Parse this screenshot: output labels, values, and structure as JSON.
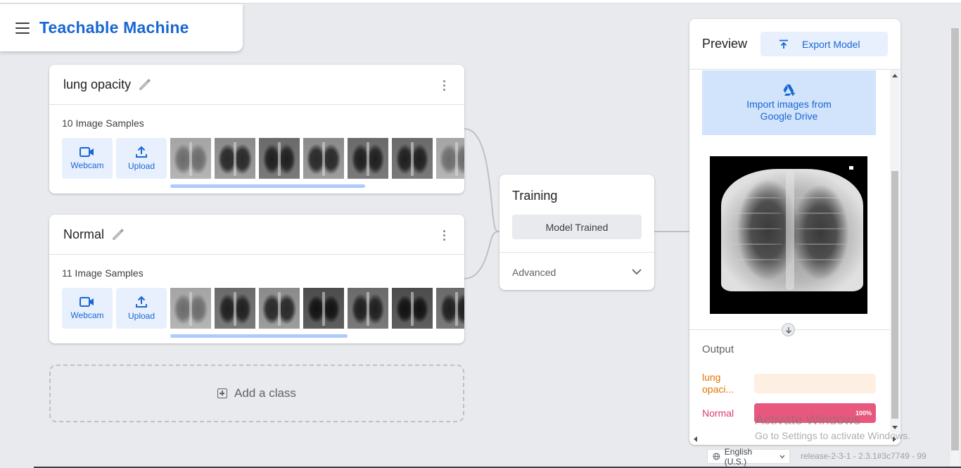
{
  "app": {
    "title": "Teachable Machine"
  },
  "classes": [
    {
      "name": "lung opacity",
      "samples_label": "10 Image Samples",
      "webcam_label": "Webcam",
      "upload_label": "Upload"
    },
    {
      "name": "Normal",
      "samples_label": "11 Image Samples",
      "webcam_label": "Webcam",
      "upload_label": "Upload"
    }
  ],
  "add_class_label": "Add a class",
  "training": {
    "title": "Training",
    "button_label": "Model Trained",
    "advanced_label": "Advanced"
  },
  "preview": {
    "title": "Preview",
    "export_label": "Export Model",
    "import_line1": "Import images from",
    "import_line2": "Google Drive",
    "output_title": "Output",
    "outputs": [
      {
        "label_line1": "lung",
        "label_line2": "opaci...",
        "percent": 0,
        "percent_label": "",
        "color": "#e37400",
        "bar_bg": "#feefe3",
        "fill_color": "#f29900"
      },
      {
        "label_line1": "Normal",
        "label_line2": "",
        "percent": 100,
        "percent_label": "100%",
        "color": "#d93c6c",
        "bar_bg": "#fce8ee",
        "fill_color": "#e8577e"
      }
    ]
  },
  "footer": {
    "language": "English (U.S.)",
    "release": "release-2-3-1 - 2.3.1#3c7749 - 99"
  },
  "watermark": {
    "title": "Activate Windows",
    "subtitle": "Go to Settings to activate Windows."
  },
  "colors": {
    "brand": "#1967d2",
    "background": "#e8eaed"
  },
  "icons": [
    "menu-icon",
    "pencil-icon",
    "more-vert-icon",
    "videocam-icon",
    "upload-icon",
    "export-icon",
    "google-drive-icon",
    "chevron-down-icon",
    "arrow-down-icon",
    "globe-icon",
    "add-box-icon"
  ]
}
